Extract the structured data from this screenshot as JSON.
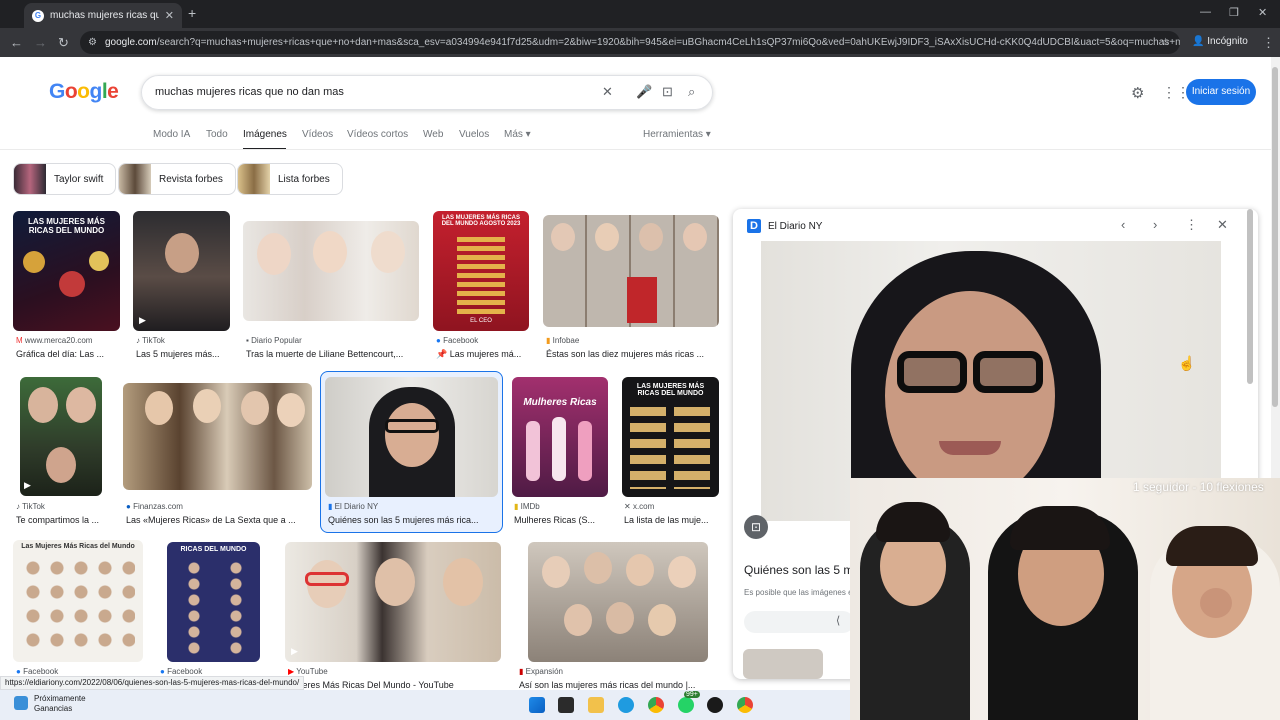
{
  "browser": {
    "tab_title": "muchas mujeres ricas que no d",
    "url_host": "google.com",
    "url_rest": "/search?q=muchas+mujeres+ricas+que+no+dan+mas&sca_esv=a034994e941f7d25&udm=2&biw=1920&bih=945&ei=uBGhacm4CeLh1sQP37mi6Qo&ved=0ahUKEwjJ9IDF3_iSAxXisUCHd-cKK0Q4dUDCBI&uact=5&oq=muchas+mujeres+r...",
    "incognito_label": "Incógnito"
  },
  "google": {
    "logo": [
      "G",
      "o",
      "o",
      "g",
      "l",
      "e"
    ],
    "query": "muchas mujeres ricas que no dan mas",
    "signin_label": "Iniciar sesión",
    "nav_tabs": [
      "Modo IA",
      "Todo",
      "Imágenes",
      "Vídeos",
      "Vídeos cortos",
      "Web",
      "Vuelos",
      "Más ▾"
    ],
    "tools_label": "Herramientas ▾",
    "chips": [
      "Taylor swift",
      "Revista forbes",
      "Lista forbes"
    ]
  },
  "results": [
    {
      "source": "www.merca20.com",
      "title": "Gráfica del día: Las ..."
    },
    {
      "source": "TikTok",
      "title": "Las 5 mujeres más..."
    },
    {
      "source": "Diario Popular",
      "title": "Tras la muerte de Liliane Bettencourt,..."
    },
    {
      "source": "Facebook",
      "title": "📌 Las mujeres má..."
    },
    {
      "source": "Infobae",
      "title": "Éstas son las diez mujeres más ricas ..."
    },
    {
      "source": "TikTok",
      "title": "Te compartimos la ..."
    },
    {
      "source": "Finanzas.com",
      "title": "Las «Mujeres Ricas» de La Sexta que a ..."
    },
    {
      "source": "El Diario NY",
      "title": "Quiénes son las 5 mujeres más rica..."
    },
    {
      "source": "IMDb",
      "title": "Mulheres Ricas (S..."
    },
    {
      "source": "x.com",
      "title": "La lista de las muje..."
    },
    {
      "source": "Facebook",
      "title": ""
    },
    {
      "source": "Facebook",
      "title": ""
    },
    {
      "source": "YouTube",
      "title": "Mujeres Más Ricas Del Mundo - YouTube"
    },
    {
      "source": "Expansión",
      "title": "Así son las mujeres más ricas del mundo |..."
    }
  ],
  "thumb_texts": {
    "t1": "LAS MUJERES MÁS RICAS DEL MUNDO",
    "t4": "LAS MUJERES MÁS RICAS DEL MUNDO AGOSTO 2023",
    "t4b": "EL CEO",
    "t9": "Mulheres Ricas",
    "t10": "LAS MUJERES MÁS RICAS DEL MUNDO",
    "t11": "Las Mujeres Más Ricas del Mundo",
    "t12": "RICAS DEL MUNDO"
  },
  "panel": {
    "source": "El Diario NY",
    "title": "Quiénes son las 5 m",
    "desc": "Es posible que las imágenes e"
  },
  "status_url": "https://eldiariony.com/2022/08/06/quienes-son-las-5-mujeres-mas-ricas-del-mundo/",
  "taskbar": {
    "weather_line1": "Próximamente",
    "weather_line2": "Ganancias",
    "badge": "99+"
  },
  "overlay": {
    "text": "1 seguidor - 10 flexiones"
  }
}
